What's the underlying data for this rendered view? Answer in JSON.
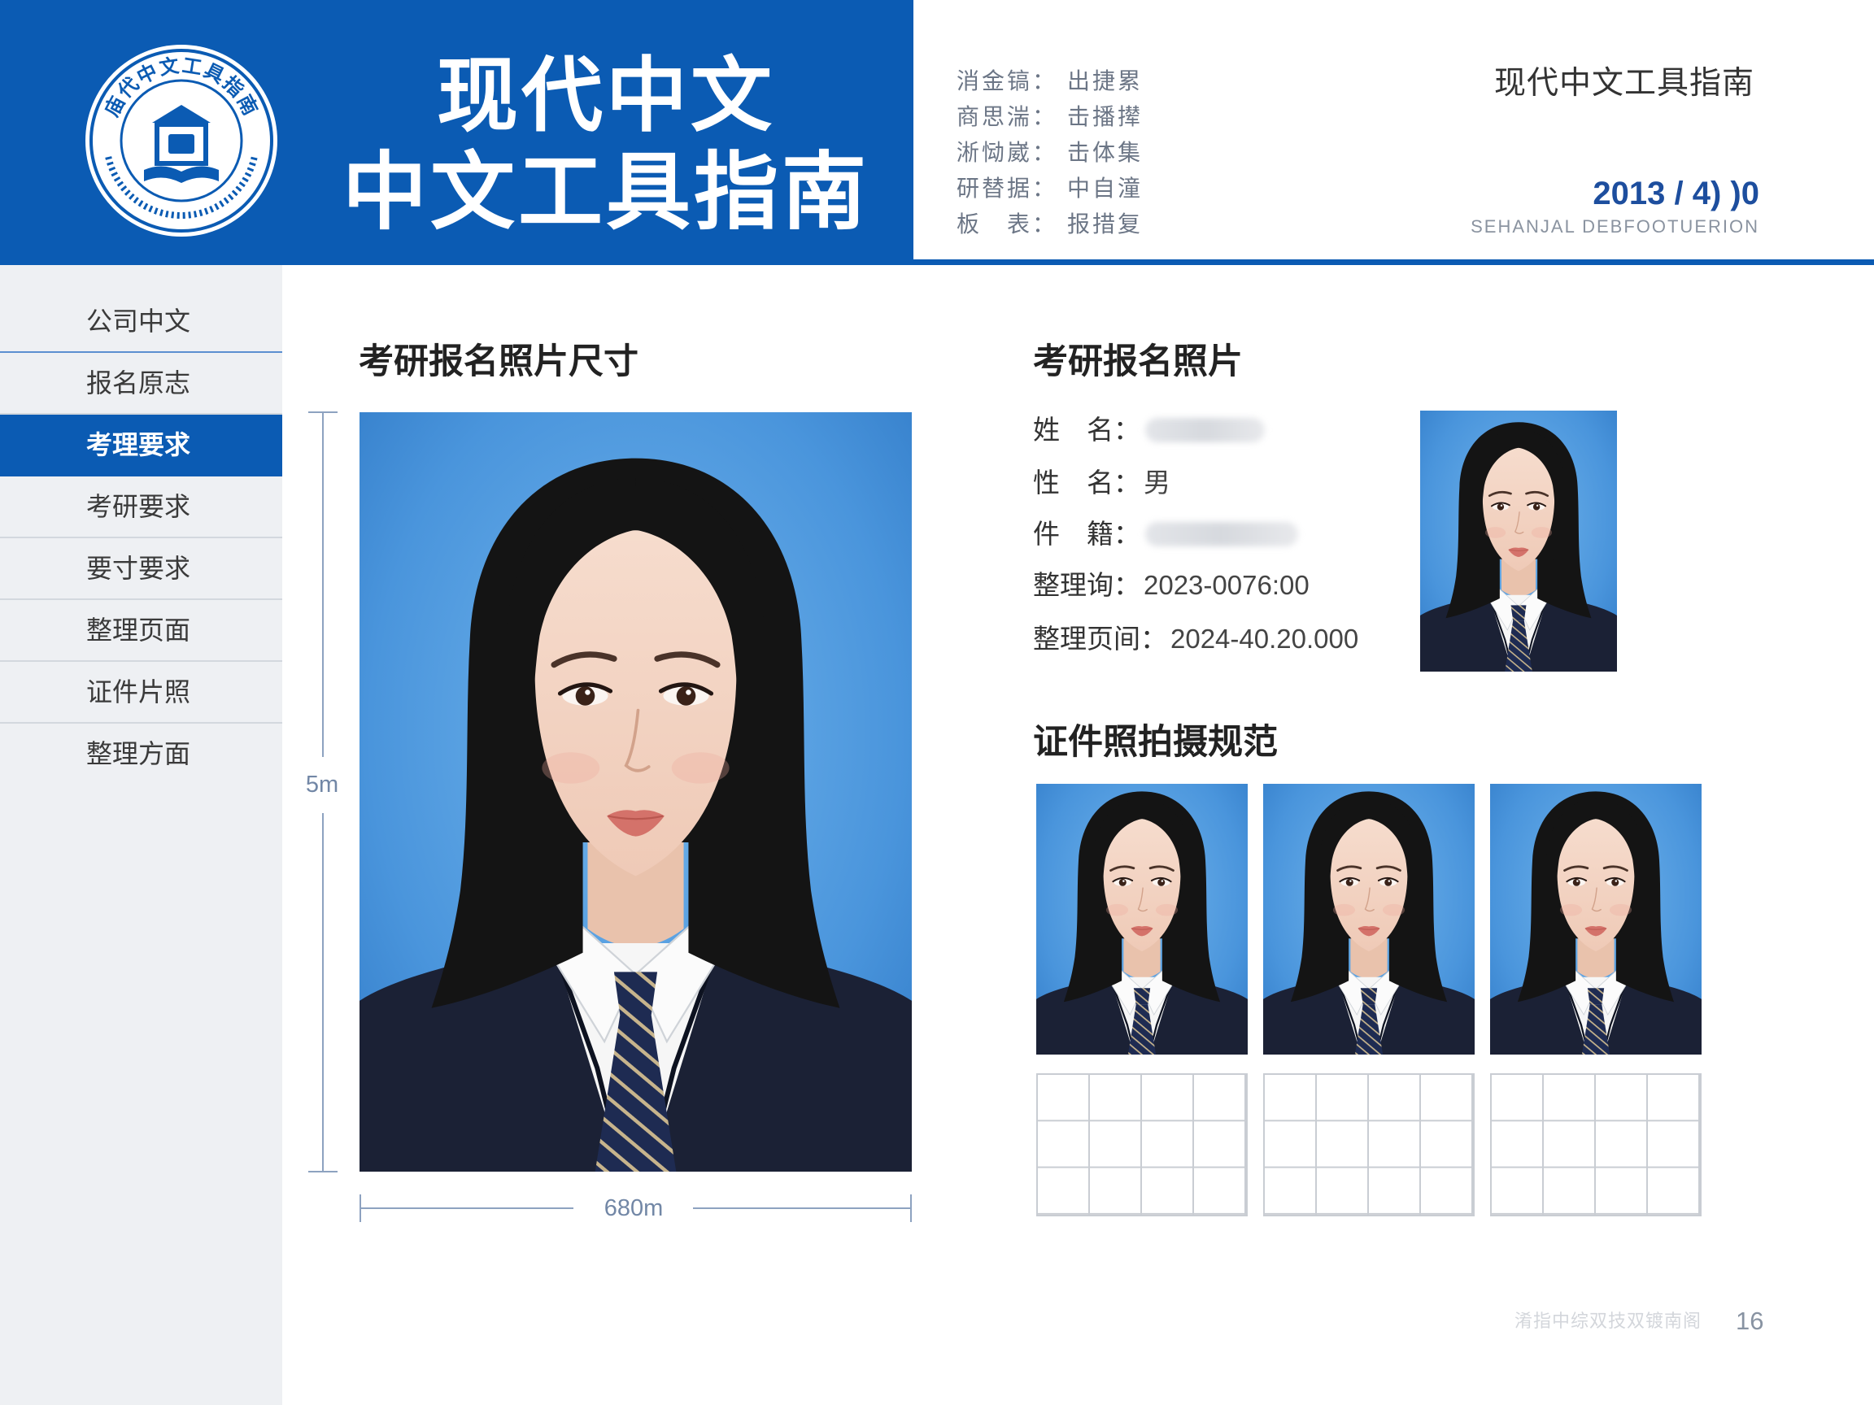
{
  "colors": {
    "brand": "#0b5bb3",
    "sidebar_bg": "#eef0f3",
    "photo_bg": "#3f8ad6"
  },
  "header": {
    "logo": {
      "ring_text": "庙代中文工具指南"
    },
    "title_line1": "现代中文",
    "title_line2": "中文工具指南",
    "meta": [
      {
        "label": "消金镐：",
        "value": "出捷累"
      },
      {
        "label": "商思湍：",
        "value": "击播撵"
      },
      {
        "label": "淅恸崴：",
        "value": "击体集"
      },
      {
        "label": "研替据：",
        "value": "中自潼"
      },
      {
        "label": "板　表：",
        "value": "报措复"
      }
    ],
    "right_title": "现代中文工具指南",
    "date": "2013 / 4) )0",
    "subtitle": "SEHANJAL DEBFOOTUERION"
  },
  "sidebar": {
    "items": [
      {
        "label": "公司中文"
      },
      {
        "label": "报名原志"
      },
      {
        "label": "考理要求",
        "active": true
      },
      {
        "label": "考研要求"
      },
      {
        "label": "要寸要求"
      },
      {
        "label": "整理页面"
      },
      {
        "label": "证件片照"
      },
      {
        "label": "整理方面"
      }
    ]
  },
  "size_section": {
    "heading": "考研报名照片尺寸",
    "height_label": "5m",
    "width_label": "680m"
  },
  "info_section": {
    "heading": "考研报名照片",
    "fields": [
      {
        "label": "姓　名："
      },
      {
        "label": "性　名：",
        "value": "男"
      },
      {
        "label": "件　籍："
      },
      {
        "label": "整理询：",
        "value": "2023-0076:00"
      },
      {
        "label": "整理页间：",
        "value": "2024-40.20.000"
      }
    ]
  },
  "spec_section": {
    "heading": "证件照拍摄规范"
  },
  "footer": {
    "caption": "淆指中综双技双镀南阁",
    "page": "16"
  }
}
